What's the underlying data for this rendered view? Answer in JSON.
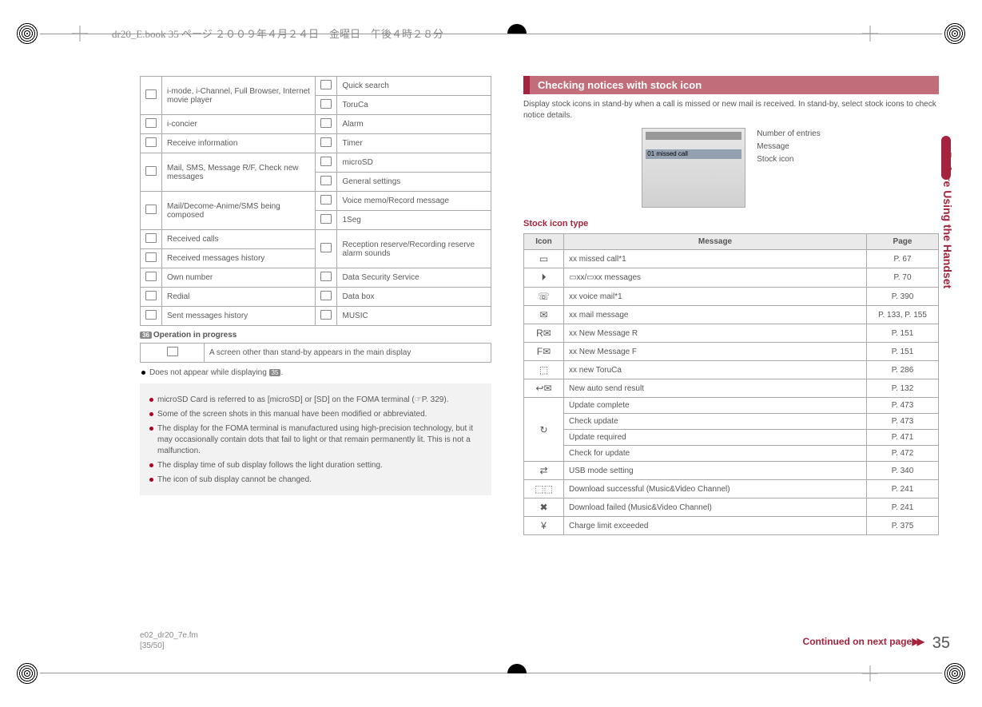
{
  "header_print_info": "dr20_E.book  35 ページ  ２００９年４月２４日　金曜日　午後４時２８分",
  "left_table": {
    "rows": [
      {
        "left": "i-mode, i-Channel, Full Browser, Internet movie player",
        "right": [
          "Quick search",
          "ToruCa"
        ],
        "left_span": 2
      },
      {
        "left": "i-concier",
        "right": [
          "Alarm"
        ]
      },
      {
        "left": "Receive information",
        "right": [
          "Timer"
        ]
      },
      {
        "left": "Mail, SMS, Message R/F, Check new messages",
        "right": [
          "microSD",
          "General settings"
        ],
        "left_span": 2
      },
      {
        "left": "Mail/Decome-Anime/SMS being composed",
        "right": [
          "Voice memo/Record message",
          "1Seg"
        ],
        "left_span": 2
      },
      {
        "left": "Received calls",
        "right_span_start": true,
        "right": [
          "Reception reserve/Recording reserve alarm sounds"
        ]
      },
      {
        "left": "Received messages history"
      },
      {
        "left": "Own number",
        "right": [
          "Data Security Service"
        ]
      },
      {
        "left": "Redial",
        "right": [
          "Data box"
        ]
      },
      {
        "left": "Sent messages history",
        "right": [
          "MUSIC"
        ]
      }
    ]
  },
  "operation": {
    "badge": "36",
    "title": "Operation in progress",
    "row_text": "A screen other than stand-by appears in the main display",
    "bullet": "Does not appear while displaying ",
    "bullet_badge": "35",
    "bullet_suffix": "."
  },
  "notes": [
    "microSD Card is referred to as [microSD] or [SD] on the FOMA terminal (☞P. 329).",
    "Some of the screen shots in this manual have been modified or abbreviated.",
    "The display for the FOMA terminal is manufactured using high-precision technology, but it may occasionally contain dots that fail to light or that remain permanently lit. This is not a malfunction.",
    "The display time of sub display follows the light duration setting.",
    "The icon of sub display cannot be changed."
  ],
  "section_title": "Checking notices with stock icon",
  "section_body": "Display stock icons in stand-by when a call is missed or new mail is received. In stand-by, select stock icons to check notice details.",
  "screenshot": {
    "bar_text": "01 missed call",
    "annot1": "Number of entries",
    "annot2": "Message",
    "annot3": "Stock icon"
  },
  "stock_heading": "Stock icon type",
  "stock_header": {
    "icon": "Icon",
    "message": "Message",
    "page": "Page"
  },
  "stock_rows": [
    {
      "glyph": "▭",
      "msg": "xx missed call*1",
      "page": "P. 67"
    },
    {
      "glyph": "⏵",
      "msg": "▭xx/▭xx messages",
      "page": "P. 70"
    },
    {
      "glyph": "☏",
      "msg": "xx voice mail*1",
      "page": "P. 390"
    },
    {
      "glyph": "✉",
      "msg": "xx mail message",
      "page": "P. 133, P. 155"
    },
    {
      "glyph": "R✉",
      "msg": "xx New Message R",
      "page": "P. 151"
    },
    {
      "glyph": "F✉",
      "msg": "xx New Message F",
      "page": "P. 151"
    },
    {
      "glyph": "⬚",
      "msg": "xx new ToruCa",
      "page": "P. 286"
    },
    {
      "glyph": "↩✉",
      "msg": "New auto send result",
      "page": "P. 132"
    },
    {
      "glyph": "↻",
      "span": 4,
      "msgs": [
        {
          "m": "Update complete",
          "p": "P. 473"
        },
        {
          "m": "Check update",
          "p": "P. 473"
        },
        {
          "m": "Update required",
          "p": "P. 471"
        },
        {
          "m": "Check for update",
          "p": "P. 472"
        }
      ]
    },
    {
      "glyph": "⇄",
      "msg": "USB mode setting",
      "page": "P. 340"
    },
    {
      "glyph": "⬚⬚",
      "msg": "Download successful (Music&Video Channel)",
      "page": "P. 241"
    },
    {
      "glyph": "✖",
      "msg": "Download failed (Music&Video Channel)",
      "page": "P. 241"
    },
    {
      "glyph": "¥",
      "msg": "Charge limit exceeded",
      "page": "P. 375"
    }
  ],
  "side_tab": "Before Using the Handset",
  "continued": "Continued on next page",
  "page_number": "35",
  "footer": {
    "line1": "e02_dr20_7e.fm",
    "line2": "[35/50]"
  }
}
